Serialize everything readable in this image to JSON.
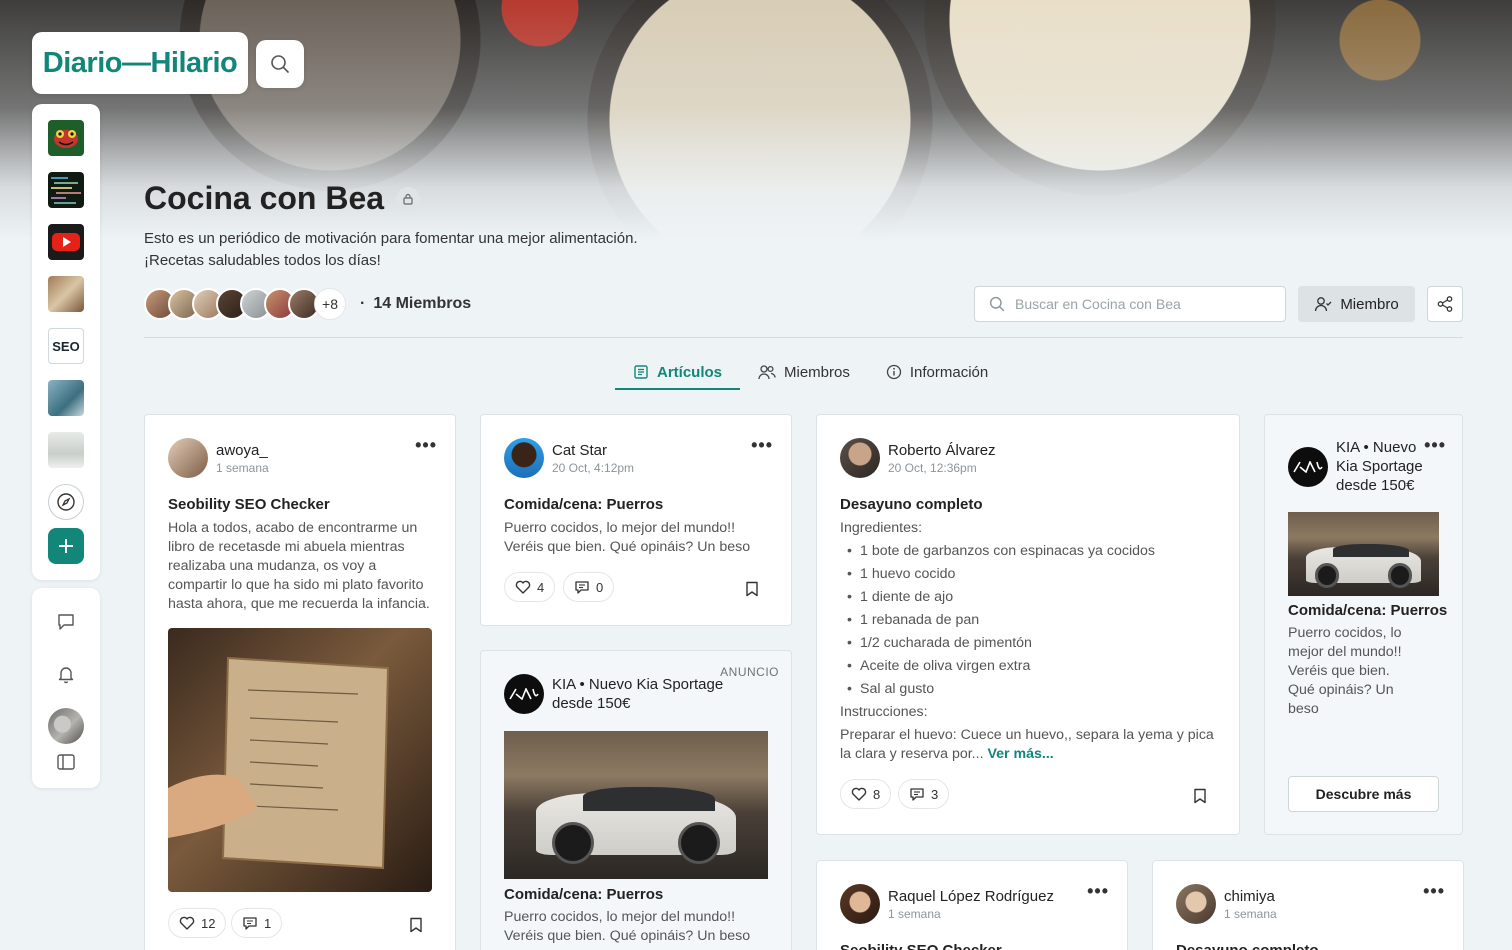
{
  "brand": {
    "logo_text": "Diario—Hilario"
  },
  "rail": {
    "apps": [
      "frog-app-icon",
      "code-app-icon",
      "youtube-app-icon",
      "food-app-icon",
      "seo-app-icon",
      "laptop-app-icon",
      "snow-app-icon"
    ],
    "seo_label": "SEO"
  },
  "group": {
    "title": "Cocina con Bea",
    "description_line1": "Esto es un periódico de motivación para fomentar una mejor alimentación.",
    "description_line2": "¡Recetas saludables todos los días!",
    "extra_members": "+8",
    "members_label": "14 Miembros",
    "search_placeholder": "Buscar en Cocina con Bea",
    "member_button": "Miembro"
  },
  "tabs": [
    {
      "label": "Artículos",
      "active": true
    },
    {
      "label": "Miembros",
      "active": false
    },
    {
      "label": "Información",
      "active": false
    }
  ],
  "posts": {
    "p1": {
      "author": "awoya_",
      "time": "1 semana",
      "title": "Seobility SEO Checker",
      "body": "Hola a todos, acabo de encontrarme un libro de recetasde mi abuela mientras realizaba una mudanza, os voy a compartir lo que ha sido mi plato favorito hasta ahora, que me recuerda la infancia.",
      "likes": "12",
      "comments": "1"
    },
    "p2": {
      "author": "Cat Star",
      "time": "20 Oct, 4:12pm",
      "title": "Comida/cena: Puerros",
      "body": "Puerro cocidos, lo mejor del mundo!! Veréis que bien. Qué opináis? Un beso",
      "likes": "4",
      "comments": "0"
    },
    "p3": {
      "author": "Roberto Álvarez",
      "time": "20 Oct, 12:36pm",
      "title": "Desayuno completo",
      "ingredients_label": "Ingredientes:",
      "ingredients": [
        "1 bote de garbanzos con espinacas ya cocidos",
        "1 huevo cocido",
        "1 diente de ajo",
        "1 rebanada de pan",
        "1/2 cucharada de pimentón",
        "Aceite de oliva virgen extra",
        "Sal al gusto"
      ],
      "instructions_label": "Instrucciones:",
      "instructions": "Preparar el huevo: Cuece un huevo,, separa la yema y pica la clara y reserva por...",
      "more": "Ver más...",
      "likes": "8",
      "comments": "3"
    },
    "p6": {
      "author": "Raquel López Rodríguez",
      "time": "1 semana",
      "title": "Seobility SEO Checker"
    },
    "p7": {
      "author": "chimiya",
      "time": "1 semana",
      "title": "Desayuno completo"
    }
  },
  "ads": {
    "a1": {
      "tag": "ANUNCIO",
      "advertiser": "KIA • Nuevo Kia Sportage desde 150€",
      "title": "Comida/cena: Puerros",
      "body": "Puerro cocidos, lo mejor del mundo!! Veréis que bien. Qué opináis? Un beso"
    },
    "a2": {
      "advertiser": "KIA • Nuevo Kia Sportage desde 150€",
      "title": "Comida/cena: Puerros",
      "body": "Puerro cocidos, lo mejor del mundo!! Veréis que bien. Qué opináis? Un beso",
      "cta": "Descubre más"
    }
  },
  "colors": {
    "accent": "#13867a",
    "background": "#eef3f6"
  }
}
